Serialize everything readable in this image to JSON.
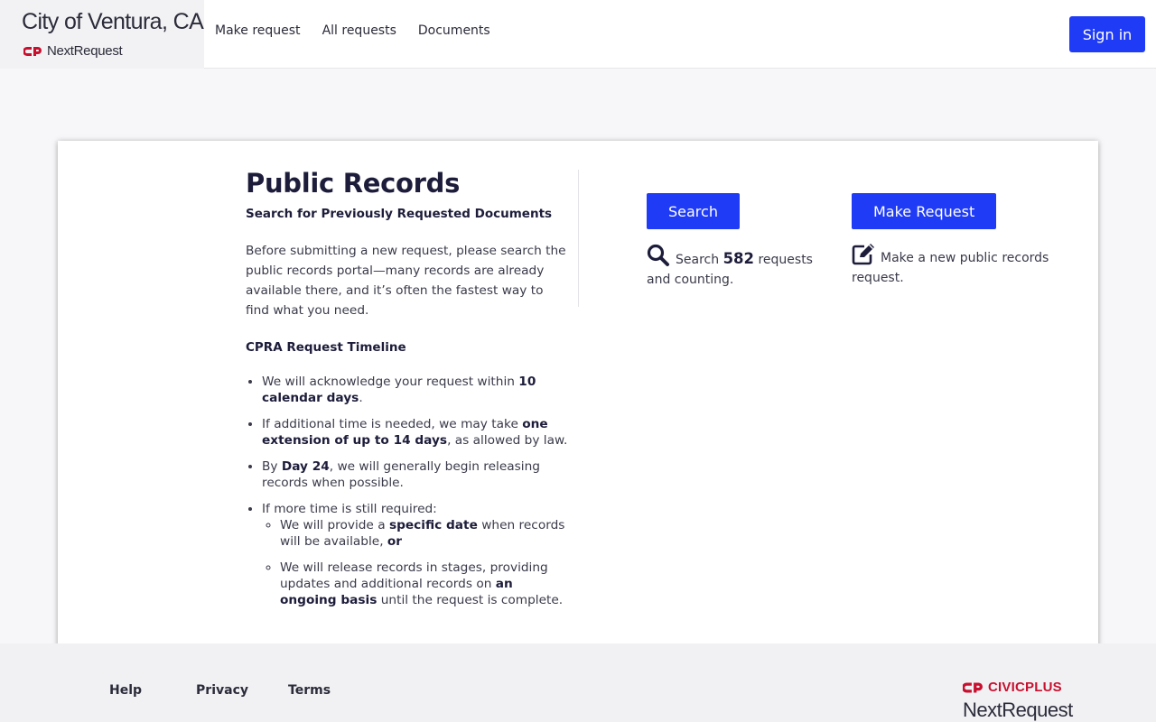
{
  "header": {
    "city_name": "City of Ventura, CA",
    "product_name": "NextRequest",
    "nav": [
      {
        "label": "Make request"
      },
      {
        "label": "All requests"
      },
      {
        "label": "Documents"
      }
    ],
    "sign_in_label": "Sign in"
  },
  "main": {
    "title": "Public Records",
    "subtitle": "Search for Previously Requested Documents",
    "intro": "Before submitting a new request, please search the public records portal—many records are already available there, and it’s often the fastest way to find what you need.",
    "timeline_heading": "CPRA Request Timeline",
    "timeline": {
      "item1_pre": "We will acknowledge your request within ",
      "item1_bold": "10 calendar days",
      "item1_post": ".",
      "item2_pre": "If additional time is needed, we may take ",
      "item2_bold": "one extension of up to 14 days",
      "item2_post": ", as allowed by law.",
      "item3_pre": "By ",
      "item3_bold": "Day 24",
      "item3_post": ", we will generally begin releasing records when possible.",
      "item4_text": "If more time is still required:",
      "sub1_pre": "We will provide a ",
      "sub1_bold": "specific date",
      "sub1_mid": " when records will be available, ",
      "sub1_bold2": "or",
      "sub2_pre": "We will release records in stages, providing updates and additional records on ",
      "sub2_bold": "an ongoing basis",
      "sub2_post": " until the request is complete."
    },
    "search_action": {
      "button_label": "Search",
      "desc_pre": "Search ",
      "count": "582",
      "desc_post": " requests and counting.",
      "icon": "search-icon"
    },
    "make_action": {
      "button_label": "Make Request",
      "desc": "Make a new public records request.",
      "icon": "edit-icon"
    }
  },
  "footer": {
    "links": [
      {
        "label": "Help"
      },
      {
        "label": "Privacy"
      },
      {
        "label": "Terms"
      }
    ],
    "brand_top": "CIVICPLUS",
    "brand_bottom": "NextRequest"
  },
  "colors": {
    "accent": "#1f3bf5",
    "brand_red": "#c8102e",
    "text_dark": "#1d1d3b"
  }
}
